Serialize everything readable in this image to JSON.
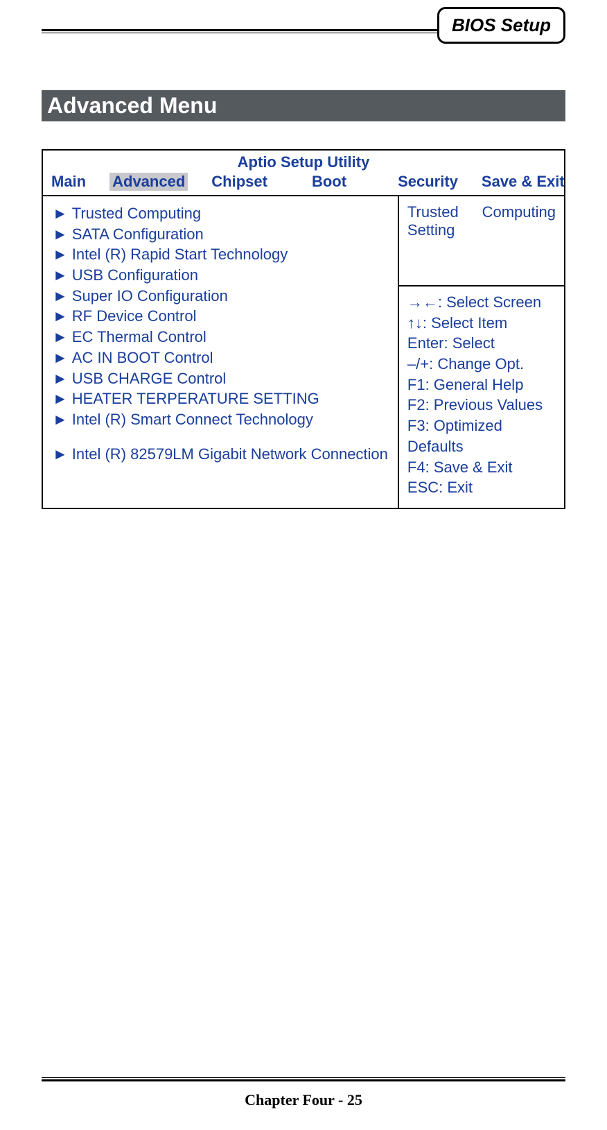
{
  "header": {
    "pill": "BIOS Setup"
  },
  "section_title": "Advanced Menu",
  "bios": {
    "title": "Aptio Setup Utility",
    "tabs": {
      "main": "Main",
      "advanced": "Advanced",
      "chipset": "Chipset",
      "boot": "Boot",
      "security": "Security",
      "save_exit": "Save & Exit"
    },
    "menu": {
      "item0": "Trusted Computing",
      "item1": "SATA Configuration",
      "item2": "Intel (R) Rapid Start Technology",
      "item3": "USB Configuration",
      "item4": "Super IO Configuration",
      "item5": "RF Device Control",
      "item6": "EC Thermal Control",
      "item7": "AC IN BOOT Control",
      "item8": "USB CHARGE Control",
      "item9": "HEATER TERPERATURE SETTING",
      "item10": "Intel (R) Smart Connect Technology",
      "item11": "Intel (R) 82579LM Gigabit Network Connection"
    },
    "desc": {
      "w1": "Trusted",
      "w2": "Computing",
      "w3": "Setting"
    },
    "help": {
      "l0": "→←: Select Screen",
      "l1": "↑↓: Select Item",
      "l2": "Enter: Select",
      "l3": "–/+: Change Opt.",
      "l4": "F1: General Help",
      "l5": "F2: Previous Values",
      "l6": "F3: Optimized Defaults",
      "l7": "F4: Save & Exit",
      "l8": "ESC: Exit"
    }
  },
  "footer": "Chapter Four - 25",
  "glyphs": {
    "arrow": "►"
  }
}
